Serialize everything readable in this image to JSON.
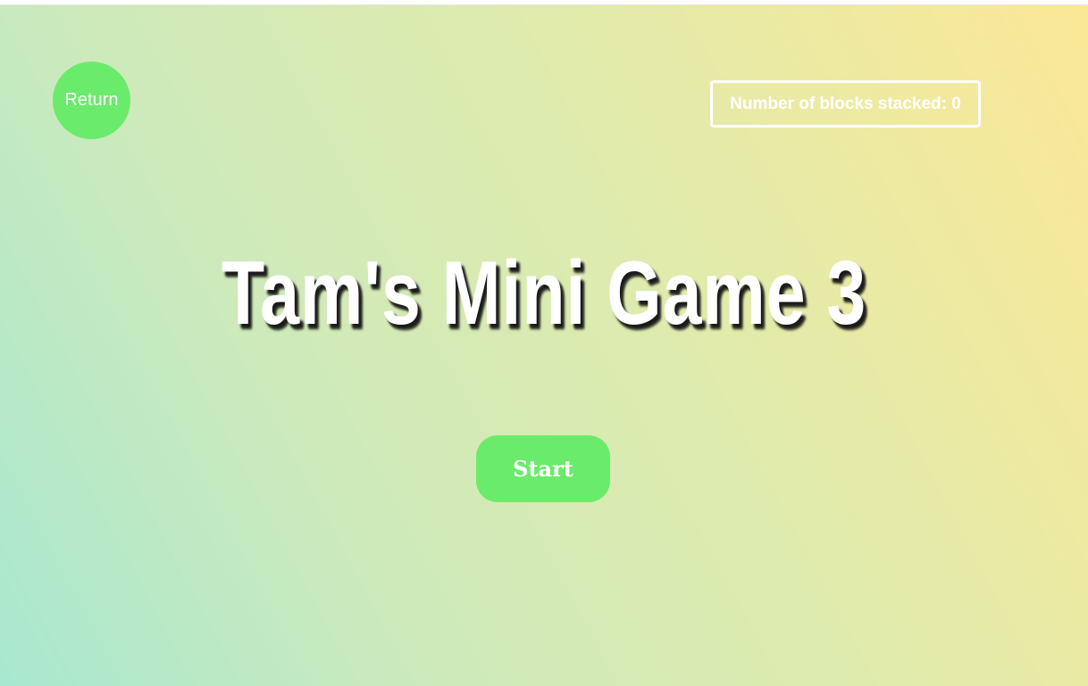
{
  "game": {
    "title": "Tam's Mini Game 3",
    "return_label": "Return",
    "start_label": "Start",
    "score_text": "Number of blocks stacked: 0",
    "blocks_stacked": 0
  },
  "colors": {
    "button_green": "#6beb6b",
    "gradient_start": "#a8e8d0",
    "gradient_end": "#fbe896",
    "text": "#ffffff"
  }
}
